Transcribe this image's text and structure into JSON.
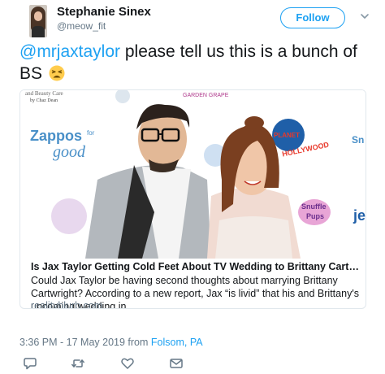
{
  "header": {
    "display_name": "Stephanie Sinex",
    "handle": "@meow_fit",
    "follow_label": "Follow"
  },
  "tweet": {
    "mention": "@mrjaxtaylor",
    "text_line1_rest": " please tell us this is a bunch of",
    "text_line2": "BS",
    "emoji": "tired-face-emoji"
  },
  "card": {
    "image_alt": "Jax Taylor and Brittany Cartwright at event",
    "backdrop_logos": [
      "Zappos for good",
      "Planet Hollywood",
      "Snuffle Pups"
    ],
    "backdrop_small_text": "by Chaz Dean",
    "title": "Is Jax Taylor Getting Cold Feet About TV Wedding to Brittany Cartwright? Plu...",
    "description": "Could Jax Taylor be having second thoughts about marrying Brittany Cartwright? According to a new report, Jax “is livid” that his and Brittany's upcoming wedding in",
    "domain": "realityblurb.com"
  },
  "meta": {
    "timestamp": "3:36 PM - 17 May 2019 from ",
    "location": "Folsom, PA"
  },
  "actions": {
    "reply_icon": "reply-icon",
    "retweet_icon": "retweet-icon",
    "like_icon": "heart-icon",
    "message_icon": "mail-icon"
  },
  "colors": {
    "accent": "#1da1f2",
    "text": "#14171a",
    "secondary": "#657786",
    "border": "#e1e8ed"
  }
}
